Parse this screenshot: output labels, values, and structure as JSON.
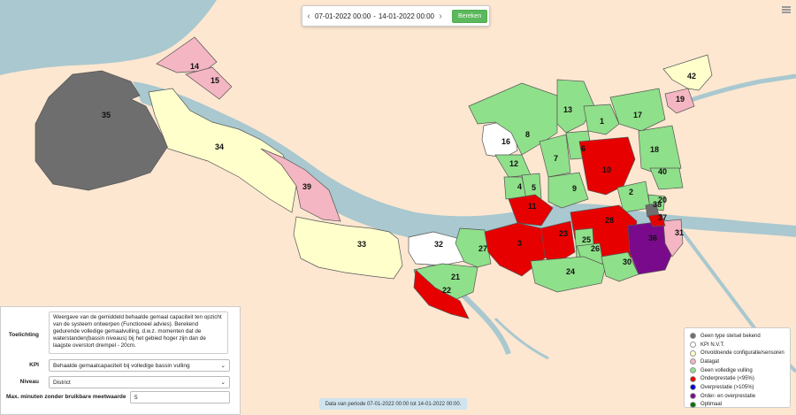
{
  "date_range": {
    "start": "07-01-2022 00:00",
    "separator": "-",
    "end": "14-01-2022 00:00",
    "calc_button": "Bereken",
    "prev_icon": "chevron-left-icon",
    "next_icon": "chevron-right-icon"
  },
  "menu_icon": "hamburger-menu-icon",
  "panel": {
    "toelichting_label": "Toelichting",
    "toelichting_text": "Weergave van de gemiddeld behaalde gemaal capaciteit ten opzicht van de systeem ontwerpen (Functioneel advies). Berekend gedurende volledige gemaalvulling, d.w.z. momenten dat de waterstanden(bassin niveaus) bij het gebied hoger zijn dan de laagste overstort drempel - 20cm.",
    "kpi_label": "KPI",
    "kpi_value": "Behaalde gemaalcapaciteit bij volledige bassin vulling",
    "niveau_label": "Niveau",
    "niveau_value": "District",
    "max_label": "Max. minuten zonder bruikbare meetwaarde",
    "max_value": "5"
  },
  "legend": [
    {
      "label": "Geen type stelsel bekend",
      "color": "#6e6e6e"
    },
    {
      "label": "KPI N.V.T.",
      "color": "#ffffff"
    },
    {
      "label": "Onvoldoende configuratie/sensoren",
      "color": "#ffffcc"
    },
    {
      "label": "Datagat",
      "color": "#f4b6c2"
    },
    {
      "label": "Geen volledige vulling",
      "color": "#8fe08a"
    },
    {
      "label": "Onderprestatie (<95%)",
      "color": "#e60000"
    },
    {
      "label": "Overprestatie (>105%)",
      "color": "#0000cc"
    },
    {
      "label": "Order- en overprestatie",
      "color": "#7a0a8c"
    },
    {
      "label": "Optimaal",
      "color": "#0a6e0a"
    }
  ],
  "footer": "Data van periode 07-01-2022 00:00 tot 14-01-2022 00:00.",
  "map": {
    "districts": [
      {
        "id": "35",
        "status": "Geen type stelsel bekend"
      },
      {
        "id": "14",
        "status": "Datagat"
      },
      {
        "id": "15",
        "status": "Datagat"
      },
      {
        "id": "34",
        "status": "Onvoldoende configuratie/sensoren"
      },
      {
        "id": "39",
        "status": "Datagat"
      },
      {
        "id": "33",
        "status": "Onvoldoende configuratie/sensoren"
      },
      {
        "id": "32",
        "status": "KPI N.V.T."
      },
      {
        "id": "27",
        "status": "Geen volledige vulling"
      },
      {
        "id": "21",
        "status": "Geen volledige vulling"
      },
      {
        "id": "22",
        "status": "Onderprestatie (<95%)"
      },
      {
        "id": "16",
        "status": "KPI N.V.T."
      },
      {
        "id": "8",
        "status": "Geen volledige vulling"
      },
      {
        "id": "13",
        "status": "Geen volledige vulling"
      },
      {
        "id": "1",
        "status": "Geen volledige vulling"
      },
      {
        "id": "17",
        "status": "Geen volledige vulling"
      },
      {
        "id": "6",
        "status": "Geen volledige vulling"
      },
      {
        "id": "7",
        "status": "Geen volledige vulling"
      },
      {
        "id": "12",
        "status": "Geen volledige vulling"
      },
      {
        "id": "4",
        "status": "Geen volledige vulling"
      },
      {
        "id": "5",
        "status": "Geen volledige vulling"
      },
      {
        "id": "9",
        "status": "Geen volledige vulling"
      },
      {
        "id": "10",
        "status": "Onderprestatie (<95%)"
      },
      {
        "id": "18",
        "status": "Geen volledige vulling"
      },
      {
        "id": "40",
        "status": "Geen volledige vulling"
      },
      {
        "id": "2",
        "status": "Geen volledige vulling"
      },
      {
        "id": "11",
        "status": "Onderprestatie (<95%)"
      },
      {
        "id": "3",
        "status": "Onderprestatie (<95%)"
      },
      {
        "id": "23",
        "status": "Onderprestatie (<95%)"
      },
      {
        "id": "28",
        "status": "Onderprestatie (<95%)"
      },
      {
        "id": "25",
        "status": "Geen volledige vulling"
      },
      {
        "id": "26",
        "status": "Geen volledige vulling"
      },
      {
        "id": "24",
        "status": "Geen volledige vulling"
      },
      {
        "id": "30",
        "status": "Geen volledige vulling"
      },
      {
        "id": "36",
        "status": "Order- en overprestatie"
      },
      {
        "id": "31",
        "status": "Datagat"
      },
      {
        "id": "20",
        "status": "Geen volledige vulling"
      },
      {
        "id": "38",
        "status": "Geen type stelsel bekend"
      },
      {
        "id": "19",
        "status": "Datagat"
      },
      {
        "id": "42",
        "status": "Onvoldoende configuratie/sensoren"
      },
      {
        "id": "37",
        "status": "Onderprestatie (<95%)"
      }
    ],
    "colors": {
      "land": "#fde7d1",
      "water": "#a9c8cf",
      "border": "#555555"
    }
  }
}
